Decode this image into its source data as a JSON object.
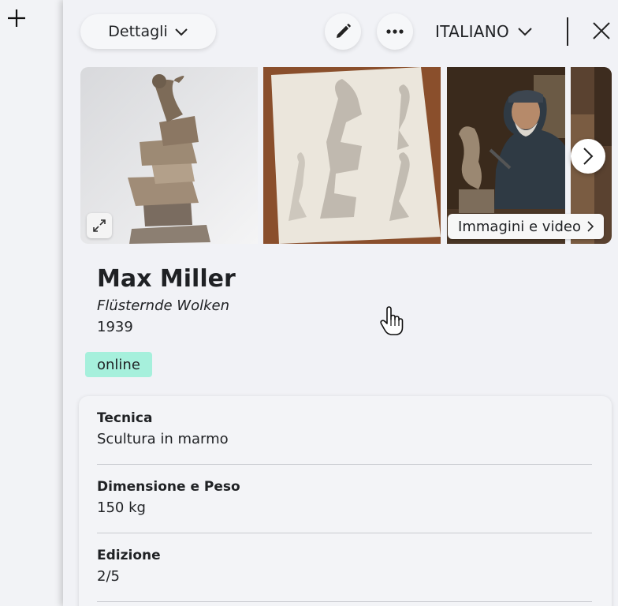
{
  "header": {
    "details_label": "Dettagli",
    "language_label": "ITALIANO",
    "edit_icon": "pencil-icon",
    "more_icon": "more-horizontal-icon",
    "close_icon": "close-icon"
  },
  "gallery": {
    "media_label": "Immagini e video",
    "expand_icon": "expand-icon",
    "next_icon": "chevron-right-icon"
  },
  "artwork": {
    "artist": "Max Miller",
    "title": "Flüsternde Wolken",
    "year": "1939",
    "status": "online"
  },
  "details": [
    {
      "label": "Tecnica",
      "value": "Scultura in marmo"
    },
    {
      "label": "Dimensione e Peso",
      "value": "150 kg"
    },
    {
      "label": "Edizione",
      "value": "2/5"
    }
  ],
  "colors": {
    "status_badge": "#a6f0dc",
    "panel_bg": "#f1f2f6"
  }
}
